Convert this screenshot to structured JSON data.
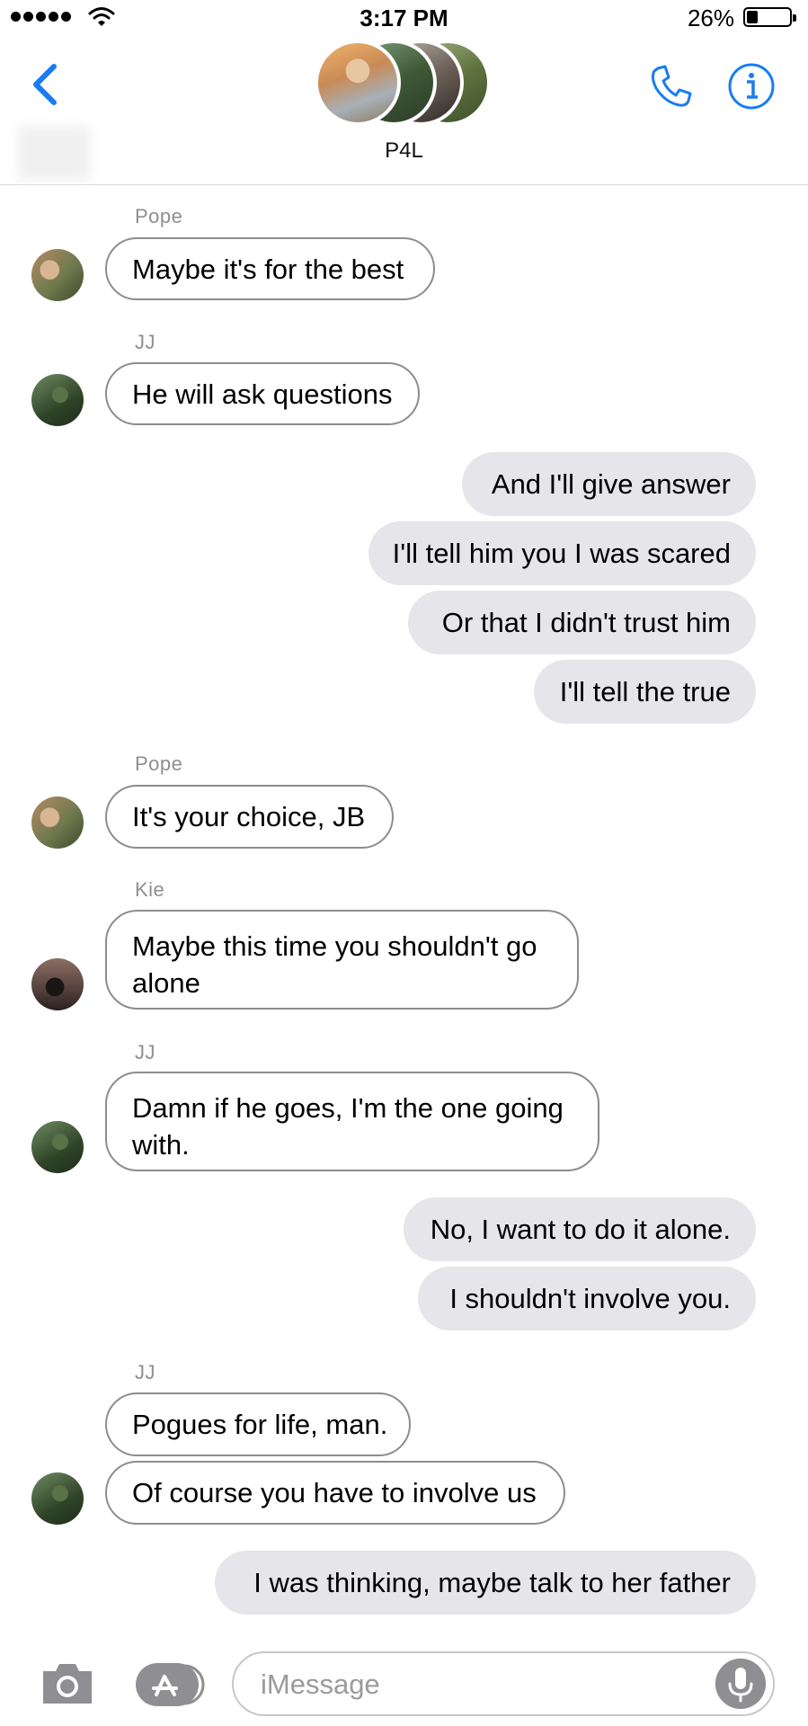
{
  "status_bar": {
    "time": "3:17 PM",
    "battery_percent": "26%",
    "battery_level": 0.26,
    "signal_bars": 5
  },
  "header": {
    "group_name": "P4L",
    "back_icon": "chevron-left-icon",
    "phone_icon": "phone-icon",
    "info_icon": "info-icon",
    "accent_color": "#1a7cf0"
  },
  "messages": [
    {
      "sender": "Pope",
      "text": "Maybe it's for the best"
    },
    {
      "sender": "JJ",
      "text": "He will ask questions"
    },
    {
      "text": "And I'll give answer"
    },
    {
      "text": "I'll tell him you I was scared"
    },
    {
      "text": "Or that I didn't trust him"
    },
    {
      "text": "I'll tell the true"
    },
    {
      "sender": "Pope",
      "text": "It's your choice, JB"
    },
    {
      "sender": "Kie",
      "text": "Maybe this time you shouldn't go alone"
    },
    {
      "sender": "JJ",
      "text": "Damn if he goes, I'm the one going with."
    },
    {
      "text": "No, I want to do it alone."
    },
    {
      "text": "I shouldn't involve you."
    },
    {
      "sender": "JJ",
      "text": "Pogues for life, man."
    },
    {
      "text": "Of course you have to involve us"
    },
    {
      "text": "I was thinking, maybe talk to her father"
    }
  ],
  "composer": {
    "placeholder": "iMessage",
    "camera_icon": "camera-icon",
    "apps_icon": "app-store-icon",
    "mic_icon": "microphone-icon"
  },
  "colors": {
    "incoming_border": "#8d8d8d",
    "outgoing_bg": "#e5e5ea",
    "sender_label": "#8e8e93"
  }
}
